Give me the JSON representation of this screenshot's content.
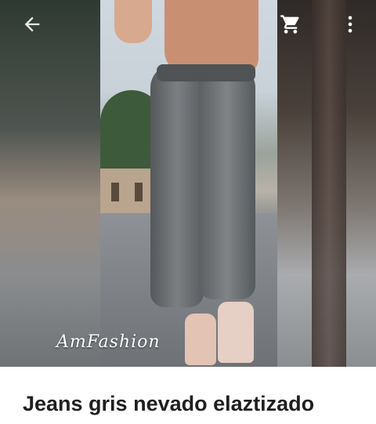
{
  "product": {
    "title": "Jeans gris nevado elaztizado",
    "image_watermark": "AmFashion"
  },
  "toolbar": {
    "back_icon": "arrow-back-icon",
    "cart_icon": "shopping-cart-icon",
    "menu_icon": "more-vert-icon"
  },
  "colors": {
    "title_text": "#1f1f1f",
    "icon": "#ffffff"
  }
}
